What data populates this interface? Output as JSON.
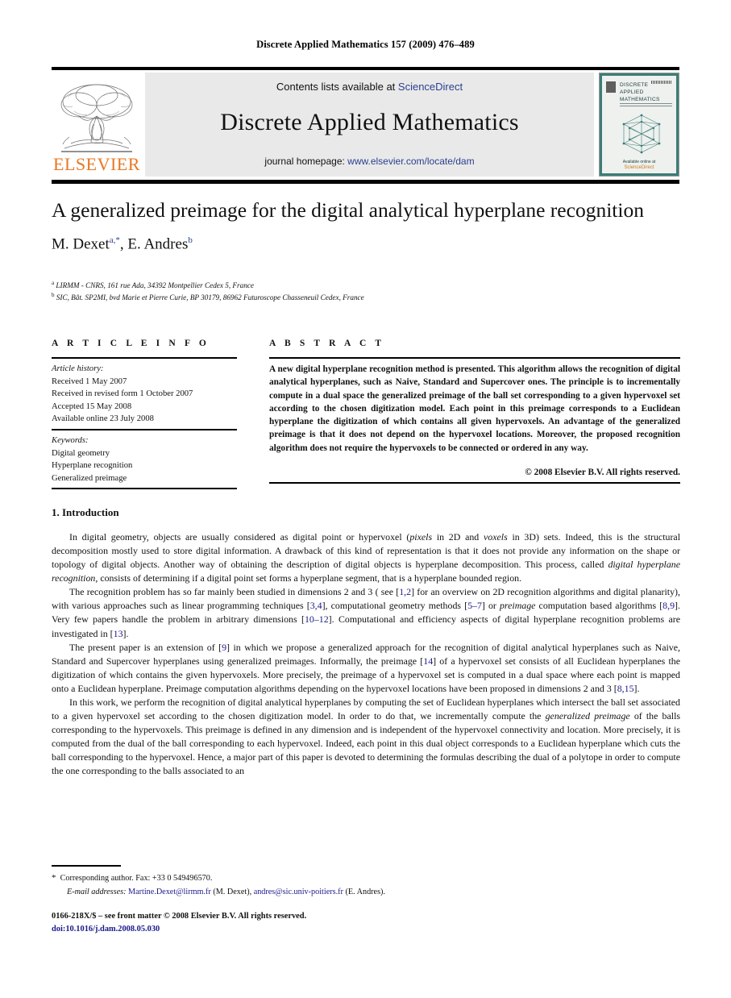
{
  "running_head": "Discrete Applied Mathematics 157 (2009) 476–489",
  "masthead": {
    "publisher": "ELSEVIER",
    "contents_prefix": "Contents lists available at ",
    "contents_link": "ScienceDirect",
    "journal_name": "Discrete Applied Mathematics",
    "homepage_prefix": "journal homepage: ",
    "homepage_link": "www.elsevier.com/locate/dam",
    "cover": {
      "line1": "DISCRETE",
      "line2": "APPLIED",
      "line3": "MATHEMATICS",
      "footer": "Available online at",
      "sciencedirect": "ScienceDirect"
    }
  },
  "article": {
    "title": "A generalized preimage for the digital analytical hyperplane recognition",
    "authors": "M. Dexet",
    "author_sup_a": "a,*",
    "author2": ", E. Andres",
    "author_sup_b": "b",
    "affiliation_a_sup": "a",
    "affiliation_a": " LIRMM - CNRS, 161 rue Ada, 34392 Montpellier Cedex 5, France",
    "affiliation_b_sup": "b",
    "affiliation_b": " SIC, Bât. SP2MI, bvd Marie et Pierre Curie, BP 30179, 86962 Futuroscope Chasseneuil Cedex, France"
  },
  "info": {
    "heading": "A R T I C L E    I N F O",
    "history_label": "Article history:",
    "history": [
      "Received 1 May 2007",
      "Received in revised form 1 October 2007",
      "Accepted 15 May 2008",
      "Available online 23 July 2008"
    ],
    "keywords_label": "Keywords:",
    "keywords": [
      "Digital geometry",
      "Hyperplane recognition",
      "Generalized preimage"
    ]
  },
  "abstract": {
    "heading": "A B S T R A C T",
    "text": "A new digital hyperplane recognition method is presented. This algorithm allows the recognition of digital analytical hyperplanes, such as Naive, Standard and Supercover ones. The principle is to incrementally compute in a dual space the generalized preimage of the ball set corresponding to a given hypervoxel set according to the chosen digitization model. Each point in this preimage corresponds to a Euclidean hyperplane the digitization of which contains all given hypervoxels. An advantage of the generalized preimage is that it does not depend on the hypervoxel locations. Moreover, the proposed recognition algorithm does not require the hypervoxels to be connected or ordered in any way.",
    "copyright": "© 2008 Elsevier B.V. All rights reserved."
  },
  "section": {
    "number_title": "1.  Introduction",
    "paragraphs": {
      "p1_a": "In digital geometry, objects are usually considered as digital point or hypervoxel (",
      "p1_em1": "pixels",
      "p1_b": " in 2D and ",
      "p1_em2": "voxels",
      "p1_c": " in 3D) sets. Indeed, this is the structural decomposition mostly used to store digital information. A drawback of this kind of representation is that it does not provide any information on the shape or topology of digital objects. Another way of obtaining the description of digital objects is hyperplane decomposition. This process, called ",
      "p1_em3": "digital hyperplane recognition",
      "p1_d": ", consists of determining if a digital point set forms a hyperplane segment, that is a hyperplane bounded region.",
      "p2_a": "The recognition problem has so far mainly been studied in dimensions 2 and 3 ( see [",
      "p2_r1": "1,2",
      "p2_b": "] for an overview on 2D recognition algorithms and digital planarity), with various approaches such as linear programming techniques [",
      "p2_r2": "3,4",
      "p2_c": "], computational geometry methods [",
      "p2_r3": "5–7",
      "p2_d": "] or ",
      "p2_em": "preimage",
      "p2_e": " computation based algorithms [",
      "p2_r4": "8,9",
      "p2_f": "]. Very few papers handle the problem in arbitrary dimensions [",
      "p2_r5": "10–12",
      "p2_g": "]. Computational and efficiency aspects of digital hyperplane recognition problems are investigated in [",
      "p2_r6": "13",
      "p2_h": "].",
      "p3_a": "The present paper is an extension of [",
      "p3_r1": "9",
      "p3_b": "] in which we propose a generalized approach for the recognition of digital analytical hyperplanes such as Naive, Standard and Supercover hyperplanes using generalized preimages. Informally, the preimage [",
      "p3_r2": "14",
      "p3_c": "] of a hypervoxel set consists of all Euclidean hyperplanes the digitization of which contains the given hypervoxels. More precisely, the preimage of a hypervoxel set is computed in a dual space where each point is mapped onto a Euclidean hyperplane. Preimage computation algorithms depending on the hypervoxel locations have been proposed in dimensions 2 and 3 [",
      "p3_r3": "8,15",
      "p3_d": "].",
      "p4_a": "In this work, we perform the recognition of digital analytical hyperplanes by computing the set of Euclidean hyperplanes which intersect the ball set associated to a given hypervoxel set according to the chosen digitization model. In order to do that, we incrementally compute the ",
      "p4_em": "generalized preimage",
      "p4_b": " of the balls corresponding to the hypervoxels. This preimage is defined in any dimension and is independent of the hypervoxel connectivity and location. More precisely, it is computed from the dual of the ball corresponding to each hypervoxel. Indeed, each point in this dual object corresponds to a Euclidean hyperplane which cuts the ball corresponding to the hypervoxel. Hence, a major part of this paper is devoted to determining the formulas describing the dual of a polytope in order to compute the one corresponding to the balls associated to an"
    }
  },
  "footnotes": {
    "star": "*",
    "corresponding": "Corresponding author. Fax: +33 0 549496570.",
    "email_label": "E-mail addresses:",
    "email1": "Martine.Dexet@lirmm.fr",
    "email1_owner": " (M. Dexet), ",
    "email2": "andres@sic.univ-poitiers.fr",
    "email2_owner": " (E. Andres).",
    "issn_line": "0166-218X/$ – see front matter © 2008 Elsevier B.V. All rights reserved.",
    "doi": "doi:10.1016/j.dam.2008.05.030"
  },
  "colors": {
    "elsevier_orange": "#E87722",
    "link_blue": "#2a3f8f",
    "ref_blue": "#1a1a8c",
    "cover_teal": "#3b7d78"
  }
}
